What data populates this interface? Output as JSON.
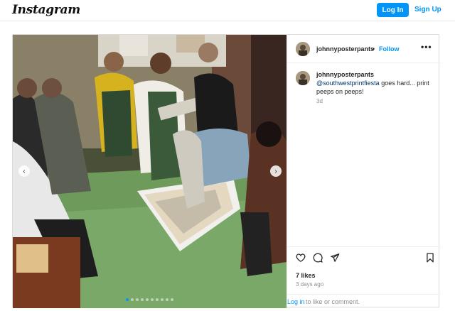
{
  "header": {
    "logo": "Instagram",
    "login_label": "Log In",
    "signup_label": "Sign Up"
  },
  "post": {
    "username": "johnnyposterpants",
    "follow_separator": "•",
    "follow_label": "Follow",
    "more_label": "•••",
    "caption": {
      "username": "johnnyposterpants",
      "mention": "@southwestprintfiesta",
      "text": " goes hard... print peeps on peeps!",
      "time": "3d"
    },
    "carousel": {
      "slide_count": 10,
      "active_index": 0
    },
    "likes": "7 likes",
    "date": "3 days ago",
    "comment_prompt": {
      "login": "Log in",
      "rest": "to like or comment."
    }
  },
  "colors": {
    "accent": "#0095f6",
    "text": "#262626",
    "muted": "#8e8e8e"
  },
  "icons": {
    "like": "heart-icon",
    "comment": "comment-icon",
    "share": "paper-plane-icon",
    "save": "bookmark-icon",
    "prev": "chevron-left-icon",
    "next": "chevron-right-icon"
  }
}
